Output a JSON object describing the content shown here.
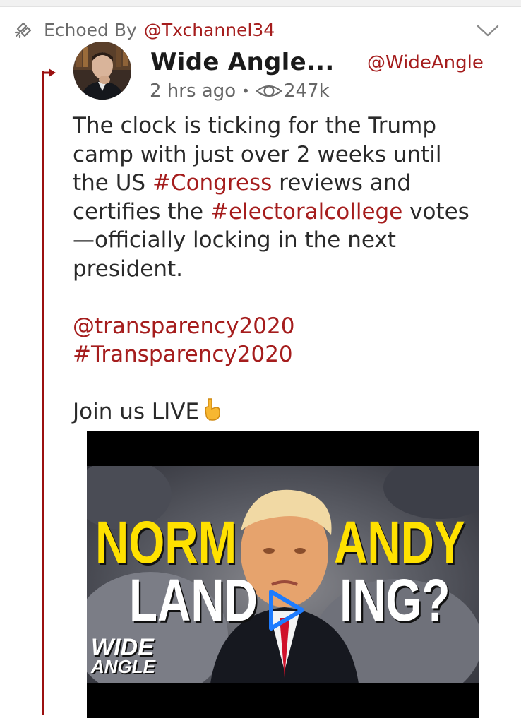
{
  "echo": {
    "prefix": "Echoed By",
    "user": "@Txchannel34"
  },
  "post": {
    "author_name": "Wide Angle...",
    "author_handle": "@WideAngle",
    "time": "2 hrs ago",
    "views": "247k",
    "text": {
      "l1": "The clock is ticking for the Trump",
      "l2": "camp with just over 2 weeks until",
      "l3a": "the US ",
      "l3_tag": "#Congress",
      "l3b": " reviews and",
      "l4a": "certifies the ",
      "l4_tag": "#electoralcollege",
      "l4b": " votes",
      "l5": "—officially locking in the next",
      "l6": "president.",
      "mention": "@transparency2020",
      "hashtag": "#Transparency2020",
      "cta": "Join us LIVE"
    }
  },
  "video": {
    "thumb_line1_left": "NORM",
    "thumb_line1_right": "ANDY",
    "thumb_line2_left": "LAND",
    "thumb_line2_right": "ING?",
    "brand_line1": "WIDE",
    "brand_line2": "ANGLE"
  },
  "colors": {
    "accent": "#a51d1d",
    "thread_line": "#9b1010",
    "play_button": "#1e7cff",
    "thumb_yellow": "#ffe100"
  },
  "icons": {
    "echo": "echo-icon",
    "chevron": "chevron-down-icon",
    "views": "eye-icon",
    "emoji": "pointing-down-emoji-icon",
    "play": "play-icon"
  }
}
